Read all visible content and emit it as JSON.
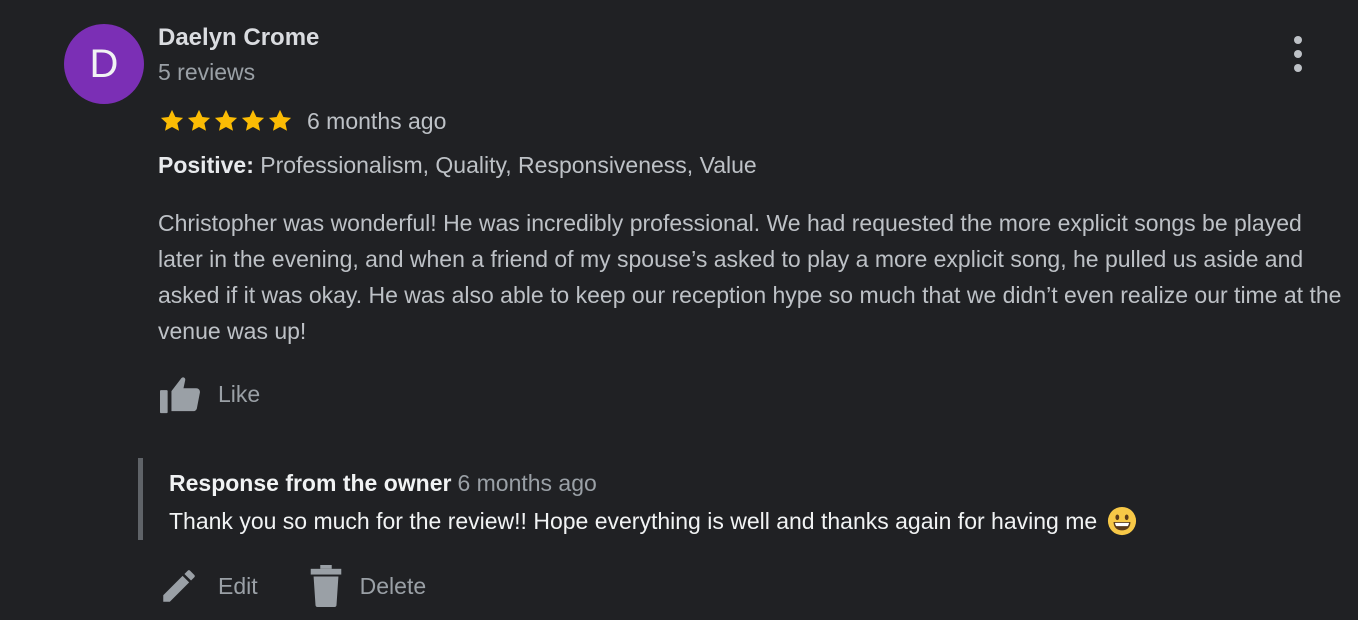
{
  "review": {
    "avatar_letter": "D",
    "avatar_color": "#7b2fb5",
    "author_name": "Daelyn Crome",
    "author_reviews": "5 reviews",
    "rating": 5,
    "rating_max": 5,
    "star_color": "#fbbc04",
    "time_ago": "6 months ago",
    "positive_label": "Positive:",
    "positive_values": "Professionalism, Quality, Responsiveness, Value",
    "text": "Christopher was wonderful! He was incredibly professional. We had requested the more explicit songs be played later in the evening, and when a friend of my spouse’s asked to play a more explicit song, he pulled us aside and asked if it was okay. He was also able to keep our reception hype so much that we didn’t even realize our time at the venue was up!",
    "like_label": "Like",
    "menu_icon": "more-vert-icon"
  },
  "owner_response": {
    "label": "Response from the owner",
    "time_ago": "6 months ago",
    "text": "Thank you so much for the review!! Hope everything is well and thanks again for having me",
    "emoji": "grinning-face-emoji"
  },
  "actions": {
    "edit_label": "Edit",
    "delete_label": "Delete"
  }
}
